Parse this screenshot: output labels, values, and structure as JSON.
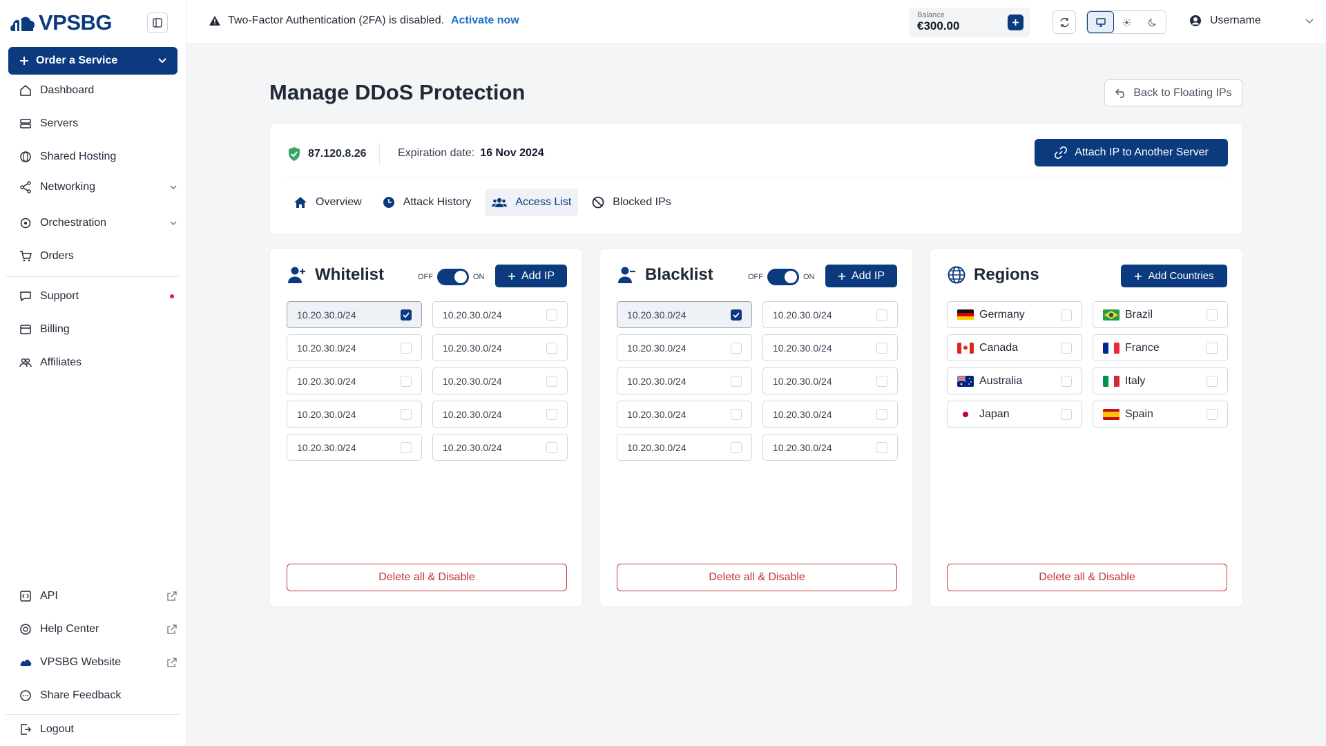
{
  "brand": {
    "name": "VPSBG"
  },
  "sidebar": {
    "order_label": "Order a Service",
    "items": [
      {
        "label": "Dashboard",
        "icon": "home-icon"
      },
      {
        "label": "Servers",
        "icon": "server-icon"
      },
      {
        "label": "Shared Hosting",
        "icon": "globe-icon"
      },
      {
        "label": "Networking",
        "icon": "share-icon"
      },
      {
        "label": "Orchestration",
        "icon": "network-icon"
      },
      {
        "label": "Orders",
        "icon": "cart-icon"
      },
      {
        "label": "Support",
        "icon": "chat-icon"
      },
      {
        "label": "Billing",
        "icon": "billing-icon"
      },
      {
        "label": "Affiliates",
        "icon": "users-icon"
      }
    ],
    "bottom_items": [
      {
        "label": "API",
        "icon": "api-icon"
      },
      {
        "label": "Help Center",
        "icon": "help-icon"
      },
      {
        "label": "VPSBG Website",
        "icon": "cloud-icon"
      },
      {
        "label": "Share Feedback",
        "icon": "feedback-icon"
      },
      {
        "label": "Logout",
        "icon": "logout-icon"
      }
    ]
  },
  "topbar": {
    "alert_text": "Two-Factor Authentication (2FA) is disabled.",
    "alert_link": "Activate now",
    "balance_label": "Balance",
    "balance_value": "€300.00",
    "username": "Username"
  },
  "page": {
    "title": "Manage DDoS Protection",
    "back_label": "Back to Floating IPs",
    "ip": "87.120.8.26",
    "expiration_label": "Expiration date:",
    "expiration_value": "16 Nov 2024",
    "attach_label": "Attach IP to Another Server",
    "tabs": [
      "Overview",
      "Attack History",
      "Access List",
      "Blocked IPs"
    ],
    "active_tab": "Access List"
  },
  "whitelist": {
    "title": "Whitelist",
    "off": "OFF",
    "on": "ON",
    "enabled": true,
    "add_label": "Add IP",
    "ips": [
      "10.20.30.0/24",
      "10.20.30.0/24",
      "10.20.30.0/24",
      "10.20.30.0/24",
      "10.20.30.0/24",
      "10.20.30.0/24",
      "10.20.30.0/24",
      "10.20.30.0/24",
      "10.20.30.0/24",
      "10.20.30.0/24"
    ],
    "selected_index": 0,
    "delete_label": "Delete all & Disable"
  },
  "blacklist": {
    "title": "Blacklist",
    "off": "OFF",
    "on": "ON",
    "enabled": true,
    "add_label": "Add IP",
    "ips": [
      "10.20.30.0/24",
      "10.20.30.0/24",
      "10.20.30.0/24",
      "10.20.30.0/24",
      "10.20.30.0/24",
      "10.20.30.0/24",
      "10.20.30.0/24",
      "10.20.30.0/24",
      "10.20.30.0/24",
      "10.20.30.0/24"
    ],
    "selected_index": 0,
    "delete_label": "Delete all & Disable"
  },
  "regions": {
    "title": "Regions",
    "add_label": "Add Countries",
    "countries": [
      "Germany",
      "Brazil",
      "Canada",
      "France",
      "Australia",
      "Italy",
      "Japan",
      "Spain"
    ],
    "delete_label": "Delete all & Disable"
  },
  "colors": {
    "primary": "#0b3a7e",
    "danger": "#c53030",
    "link": "#1d6fc7",
    "alert_dot": "#e11d48"
  }
}
